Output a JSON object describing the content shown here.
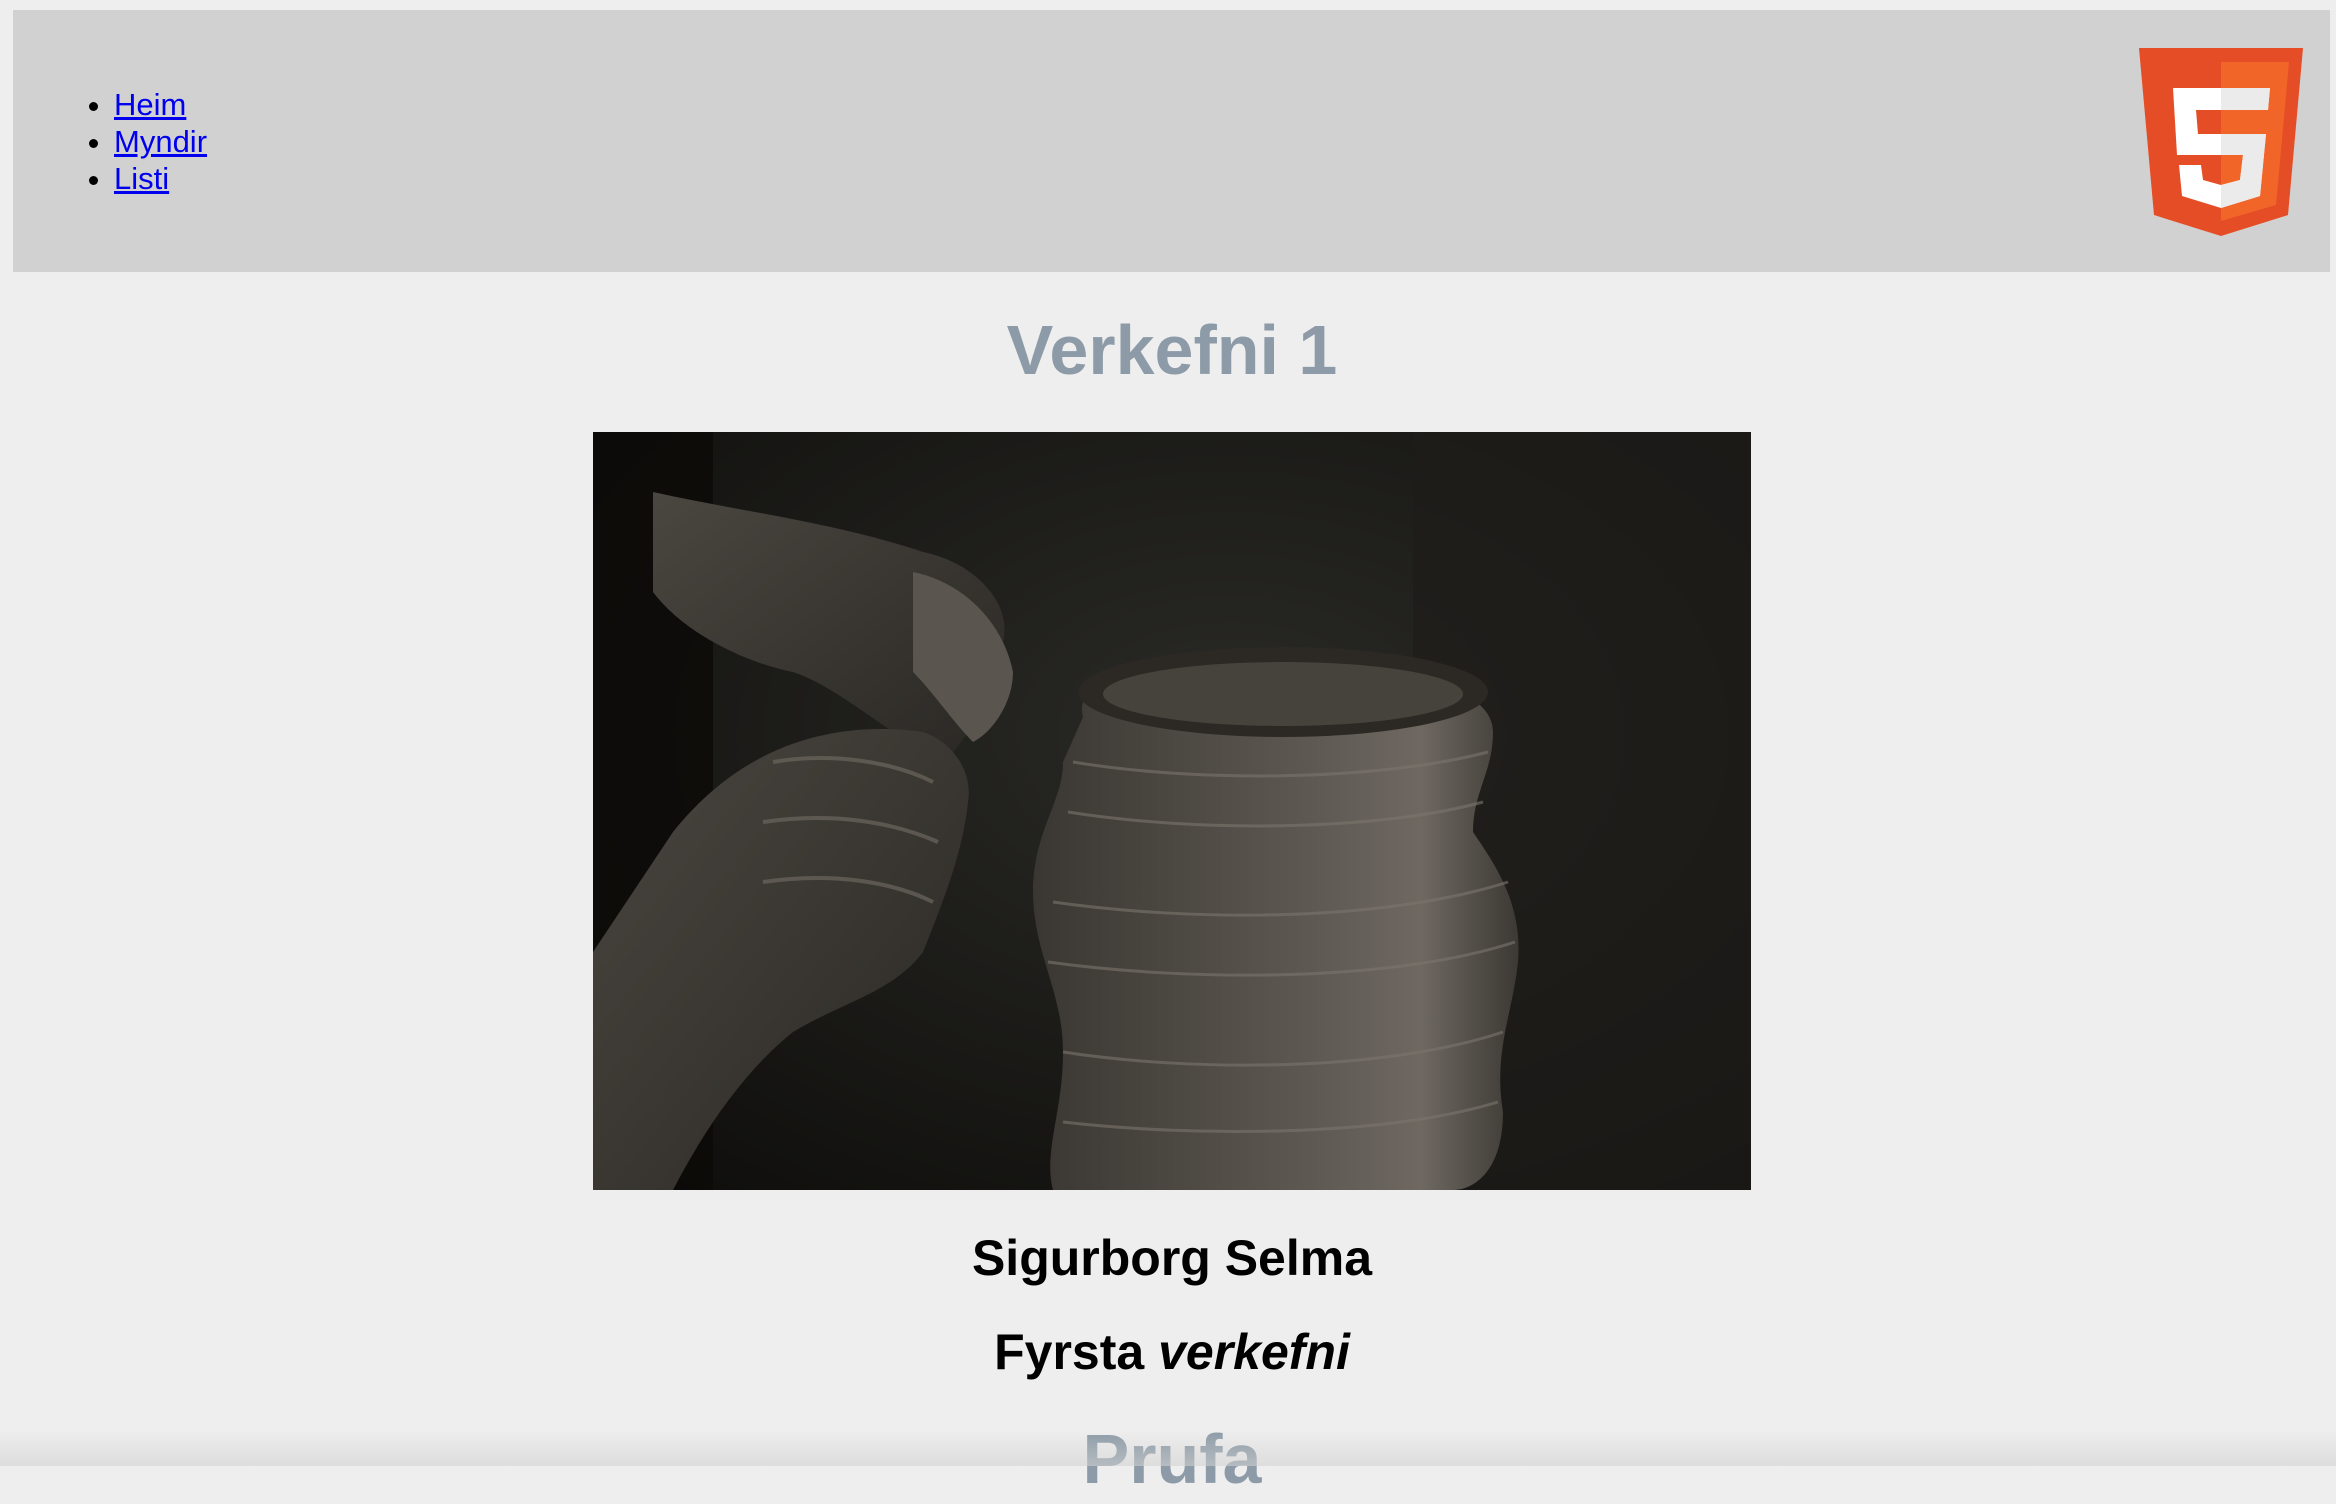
{
  "nav": {
    "items": [
      {
        "label": "Heim"
      },
      {
        "label": "Myndir"
      },
      {
        "label": "Listi"
      }
    ]
  },
  "logo": {
    "icon": "html5-logo-icon",
    "colors": {
      "outer": "#e44d26",
      "inner": "#f16529",
      "glyph": "#ffffff"
    }
  },
  "main": {
    "title": "Verkefni 1",
    "image": {
      "description_icon": "pottery-photo"
    },
    "name": "Sigurborg Selma",
    "subtitle_plain": "Fyrsta",
    "subtitle_italic": "verkefni",
    "next_heading": "Prufa"
  },
  "colors": {
    "background": "#eeeeee",
    "header_bg": "#d1d1d1",
    "heading": "#8c9ba7",
    "link": "#0000ee"
  }
}
